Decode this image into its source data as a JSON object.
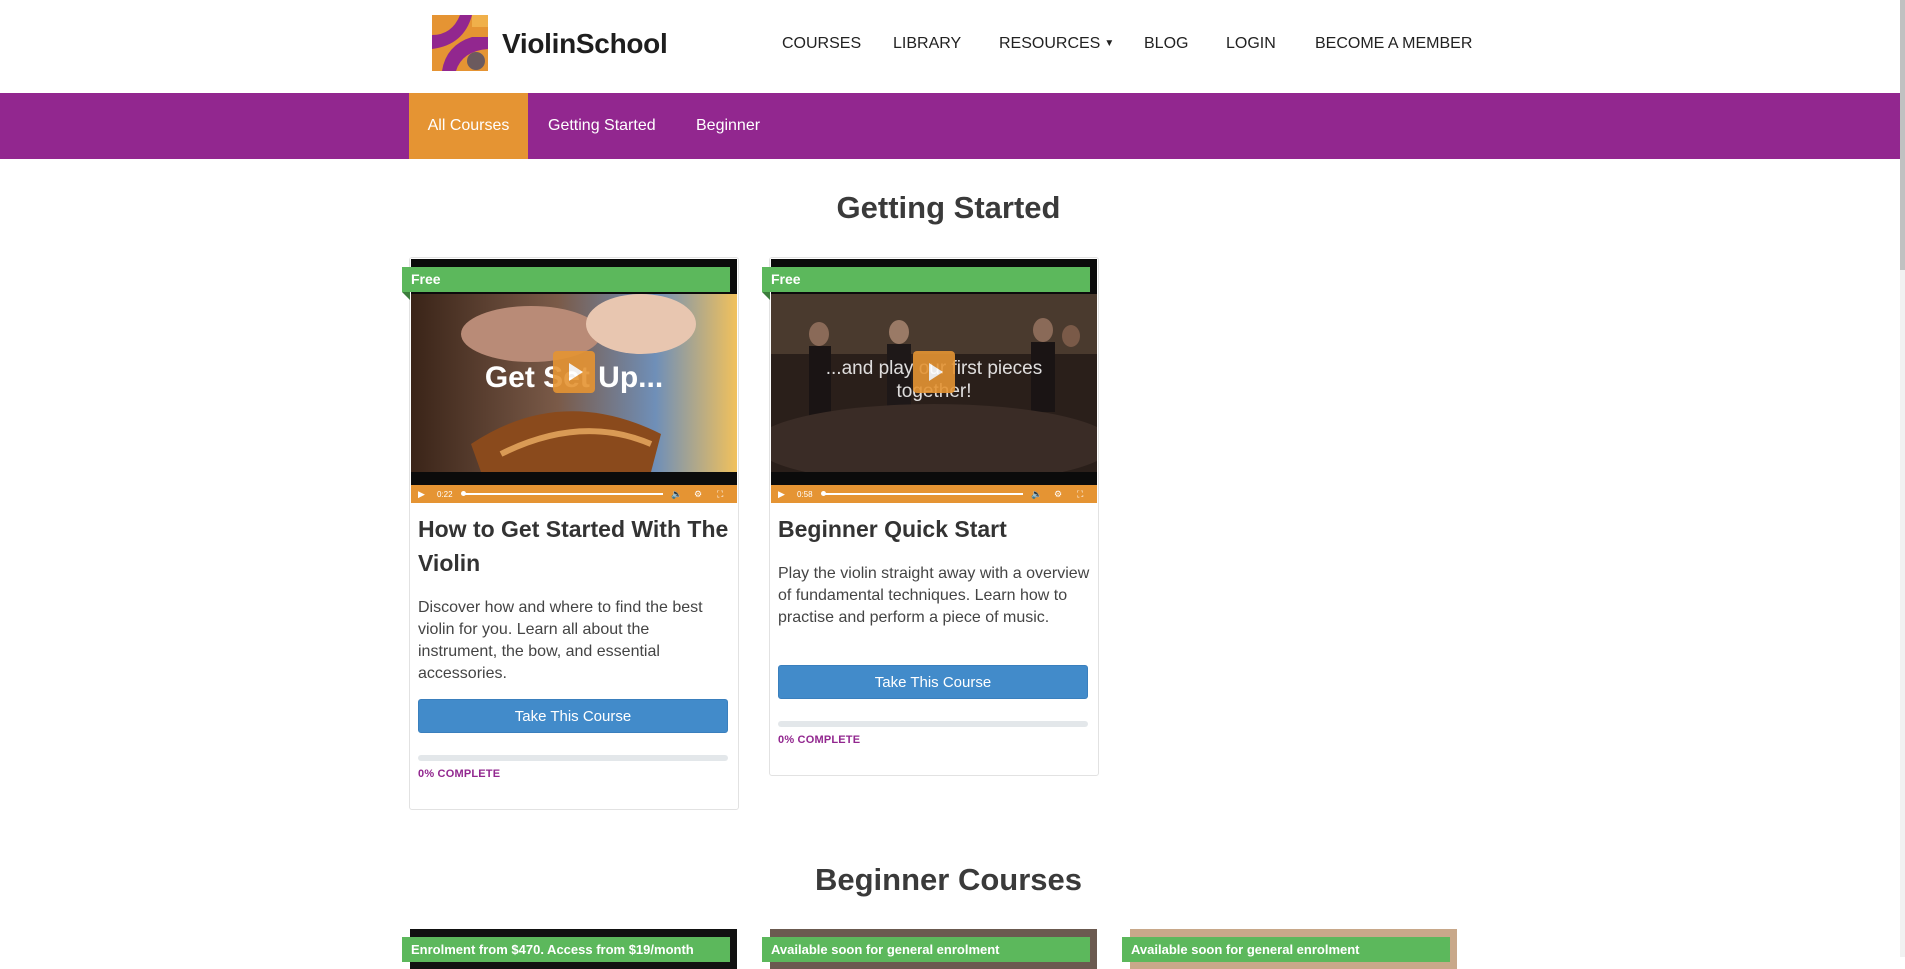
{
  "brand": {
    "name": "ViolinSchool"
  },
  "nav": {
    "courses": "COURSES",
    "library": "LIBRARY",
    "resources": "RESOURCES",
    "blog": "BLOG",
    "login": "LOGIN",
    "member": "BECOME A MEMBER"
  },
  "subnav": {
    "all": "All Courses",
    "getting_started": "Getting Started",
    "beginner": "Beginner"
  },
  "sections": {
    "getting_started": "Getting Started",
    "beginner": "Beginner Courses"
  },
  "cards": [
    {
      "ribbon": "Free",
      "overlay": "Get Set Up...",
      "time": "0:22",
      "title": "How to Get Started With The Violin",
      "description": "Discover how and where to find the best violin for you. Learn all about the instrument, the bow, and essential accessories.",
      "button": "Take This Course",
      "progress": 0,
      "complete": "0% COMPLETE"
    },
    {
      "ribbon": "Free",
      "overlay": "...and play our first pieces together!",
      "time": "0:58",
      "title": "Beginner Quick Start",
      "description": "Play the violin straight away with a overview of fundamental techniques. Learn how to practise and perform a piece of music.",
      "button": "Take This Course",
      "progress": 0,
      "complete": "0% COMPLETE"
    }
  ],
  "beginner_cards": [
    {
      "ribbon": "Enrolment from $470. Access from $19/month"
    },
    {
      "ribbon": "Available soon for general enrolment"
    },
    {
      "ribbon": "Available soon for general enrolment"
    }
  ],
  "colors": {
    "brand_purple": "#92278f",
    "accent_orange": "#e59433",
    "ribbon_green": "#5cb85c",
    "button_blue": "#428bca"
  },
  "icons": {
    "play": "play-icon",
    "volume": "volume-icon",
    "settings": "settings-icon",
    "fullscreen": "fullscreen-icon",
    "dropdown": "chevron-down-icon"
  }
}
